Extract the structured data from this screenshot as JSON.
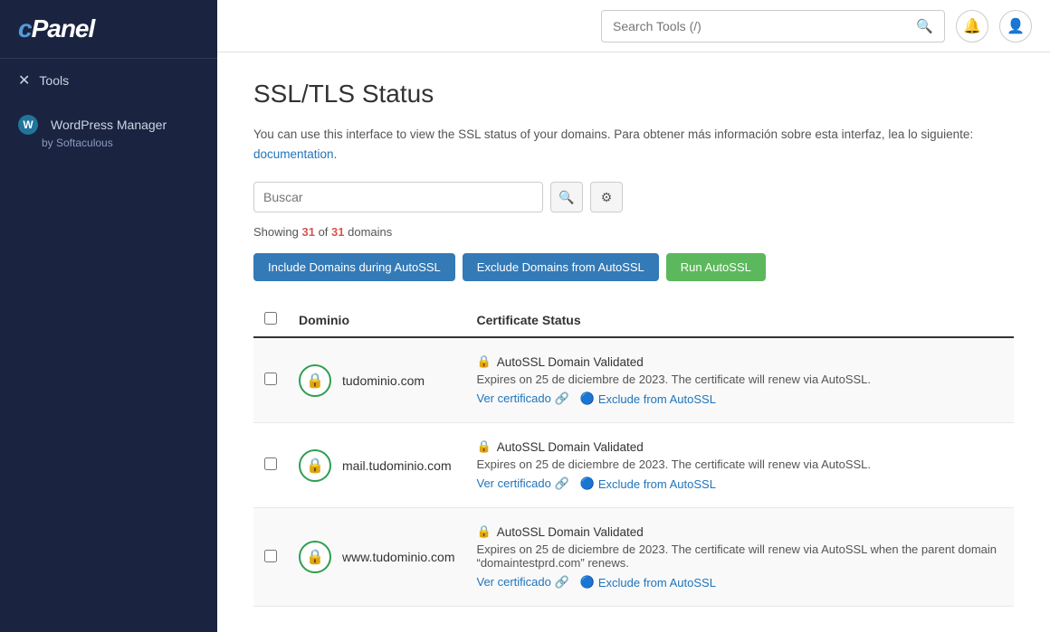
{
  "sidebar": {
    "logo": "cPanel",
    "nav": [
      {
        "id": "tools",
        "icon": "✕",
        "label": "Tools"
      },
      {
        "id": "wordpress-manager",
        "icon": "W",
        "label": "WordPress Manager",
        "sub": "by Softaculous"
      }
    ]
  },
  "header": {
    "search_placeholder": "Search Tools (/)",
    "search_value": ""
  },
  "page": {
    "title": "SSL/TLS Status",
    "description_plain": "You can use this interface to view the SSL status of your domains. Para obtener más información sobre esta interfaz, lea lo siguiente:",
    "description_link_text": "documentation",
    "description_link_suffix": ".",
    "filter_placeholder": "Buscar",
    "showing_prefix": "Showing ",
    "showing_count": "31",
    "showing_of": " of ",
    "showing_total": "31",
    "showing_suffix": " domains",
    "buttons": {
      "include": "Include Domains during AutoSSL",
      "exclude": "Exclude Domains from AutoSSL",
      "run": "Run AutoSSL"
    },
    "table": {
      "col_checkbox": "",
      "col_domain": "Dominio",
      "col_status": "Certificate Status"
    },
    "domains": [
      {
        "id": 1,
        "name": "tudominio.com",
        "status_label": "AutoSSL Domain Validated",
        "expires": "Expires on 25 de diciembre de 2023. The certificate will renew via AutoSSL.",
        "ver_cert": "Ver certificado",
        "exclude_label": "Exclude from AutoSSL",
        "bg": "odd"
      },
      {
        "id": 2,
        "name": "mail.tudominio.com",
        "status_label": "AutoSSL Domain Validated",
        "expires": "Expires on 25 de diciembre de 2023. The certificate will renew via AutoSSL.",
        "ver_cert": "Ver certificado",
        "exclude_label": "Exclude from AutoSSL",
        "bg": "even"
      },
      {
        "id": 3,
        "name": "www.tudominio.com",
        "status_label": "AutoSSL Domain Validated",
        "expires": "Expires on 25 de diciembre de 2023. The certificate will renew via AutoSSL when the parent domain “domaintestprd.com” renews.",
        "ver_cert": "Ver certificado",
        "exclude_label": "Exclude from AutoSSL",
        "bg": "odd"
      }
    ]
  }
}
